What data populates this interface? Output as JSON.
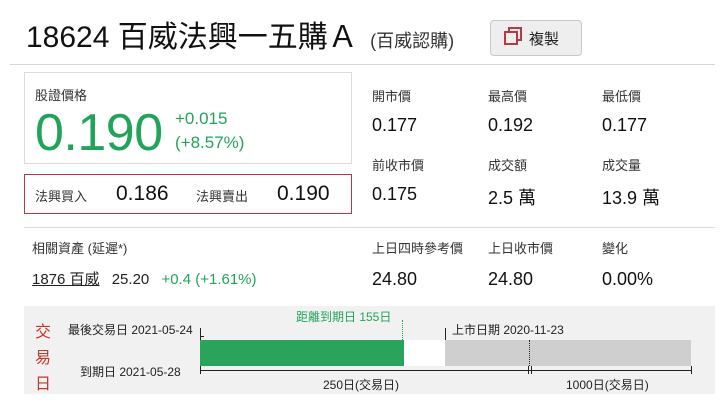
{
  "header": {
    "code": "18624",
    "name": "百威法興一五購Ａ",
    "type": "(百威認購)",
    "copy_label": "複製"
  },
  "price": {
    "label": "股證價格",
    "value": "0.190",
    "change": "+0.015",
    "change_pct": "(+8.57%)"
  },
  "bid_ask": {
    "bid_label": "法興買入",
    "bid_value": "0.186",
    "ask_label": "法興賣出",
    "ask_value": "0.190"
  },
  "stats": {
    "open_label": "開市價",
    "open": "0.177",
    "high_label": "最高價",
    "high": "0.192",
    "low_label": "最低價",
    "low": "0.177",
    "prev_close_label": "前收市價",
    "prev_close": "0.175",
    "turnover_label": "成交額",
    "turnover": "2.5 萬",
    "volume_label": "成交量",
    "volume": "13.9 萬"
  },
  "related": {
    "label": "相關資產 (延遲*)",
    "link": "1876 百威",
    "price": "25.20",
    "change": "+0.4 (+1.61%)",
    "ref_label": "上日四時參考價",
    "ref": "24.80",
    "close_label": "上日收市價",
    "close": "24.80",
    "chg_label": "變化",
    "chg": "0.00%"
  },
  "timeline": {
    "vertical_label": [
      "交",
      "易",
      "日"
    ],
    "last_trade": "最後交易日 2021-05-24",
    "expiry": "到期日 2021-05-28",
    "days_to_expiry": "距離到期日 155日",
    "listing_date": "上市日期 2020-11-23",
    "span_250": "250日(交易日)",
    "span_1000": "1000日(交易日)",
    "colors": {
      "elapsed": "#2aa35c",
      "remaining_bg": "#cfcfcf",
      "accent": "#22a35a",
      "vertical_label": "#c0392b"
    }
  },
  "colors": {
    "up": "#22a35a",
    "bidask_border": "#b53a45"
  }
}
